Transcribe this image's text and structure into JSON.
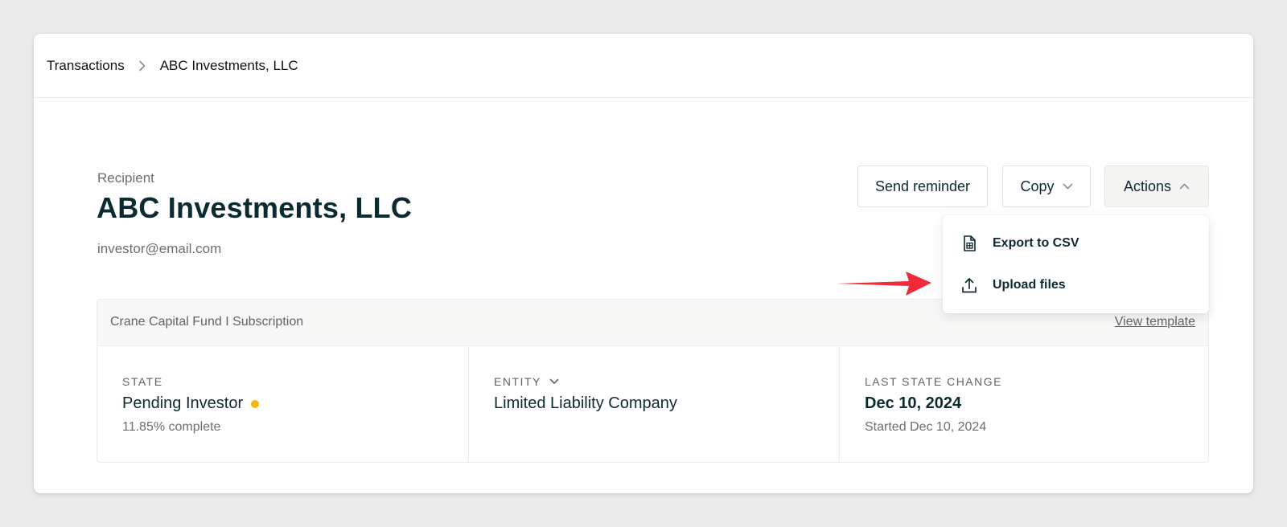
{
  "breadcrumb": {
    "items": [
      "Transactions",
      "ABC Investments, LLC"
    ]
  },
  "recipient": {
    "label": "Recipient",
    "name": "ABC Investments, LLC",
    "email": "investor@email.com"
  },
  "toolbar": {
    "send_reminder": "Send reminder",
    "copy": "Copy",
    "actions": "Actions"
  },
  "actions_menu": {
    "items": [
      {
        "label": "Export to CSV",
        "icon": "csv-file-icon"
      },
      {
        "label": "Upload files",
        "icon": "upload-icon"
      }
    ]
  },
  "annotation": {
    "arrow_color": "#f0293b"
  },
  "subscription": {
    "title": "Crane Capital Fund I Subscription",
    "view_template": "View template",
    "columns": [
      {
        "label": "STATE",
        "value": "Pending Investor",
        "sub": "11.85% complete",
        "status_color": "#f5b60d"
      },
      {
        "label": "ENTITY",
        "value": "Limited Liability Company"
      },
      {
        "label": "LAST STATE CHANGE",
        "value": "Dec 10, 2024",
        "sub": "Started Dec 10, 2024"
      }
    ]
  }
}
